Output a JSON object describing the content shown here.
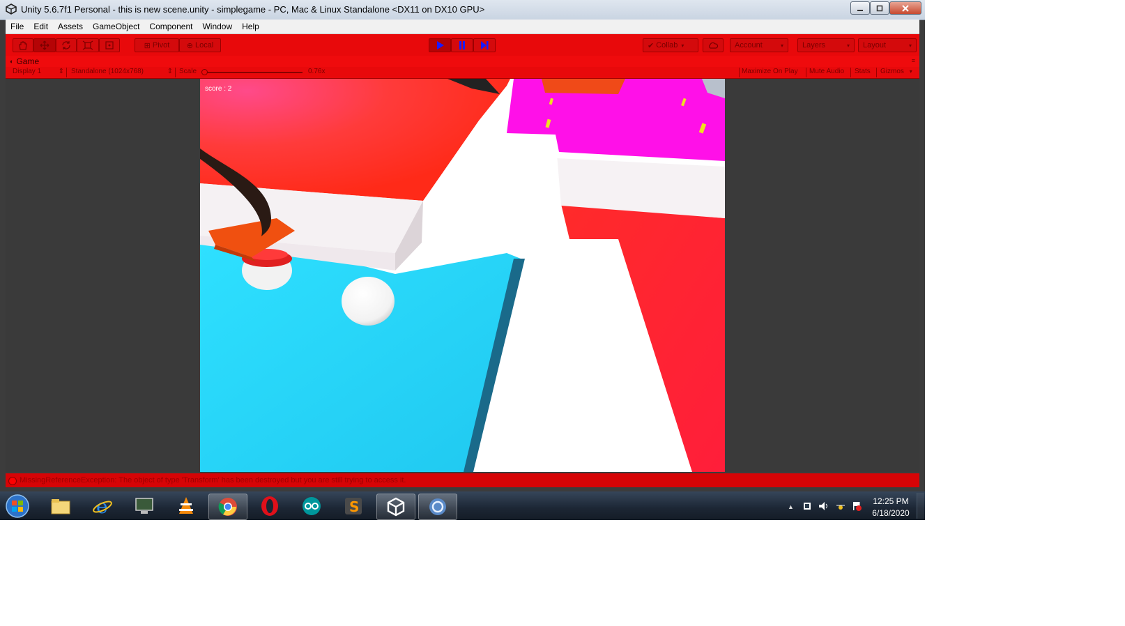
{
  "window": {
    "title": "Unity 5.6.7f1 Personal - this is new scene.unity - simplegame - PC, Mac & Linux Standalone <DX11 on DX10 GPU>"
  },
  "menu": [
    "File",
    "Edit",
    "Assets",
    "GameObject",
    "Component",
    "Window",
    "Help"
  ],
  "toolbar": {
    "pivot_label": "Pivot",
    "local_label": "Local",
    "collab_label": "Collab",
    "account_label": "Account",
    "layers_label": "Layers",
    "layout_label": "Layout",
    "play_state": "playing",
    "accent_color": "#e8090b",
    "play_icon_color": "#1a1aff"
  },
  "game_panel": {
    "tab_label": "Game",
    "display": "Display 1",
    "resolution": "Standalone (1024x768)",
    "scale_label": "Scale",
    "scale_value": "0.76x",
    "maximize_label": "Maximize On Play",
    "mute_label": "Mute Audio",
    "stats_label": "Stats",
    "gizmos_label": "Gizmos"
  },
  "game": {
    "score_text": "score : 2"
  },
  "status": {
    "message": "MissingReferenceException: The object of type 'Transform' has been destroyed but you are still trying to access it."
  },
  "taskbar": {
    "apps": [
      "start-orb-icon",
      "explorer-icon",
      "internet-explorer-icon",
      "computer-icon",
      "vlc-icon",
      "chrome-icon",
      "opera-icon",
      "arduino-icon",
      "sublime-text-icon",
      "unity-icon",
      "app-icon"
    ],
    "time": "12:25 PM",
    "date": "6/18/2020"
  }
}
